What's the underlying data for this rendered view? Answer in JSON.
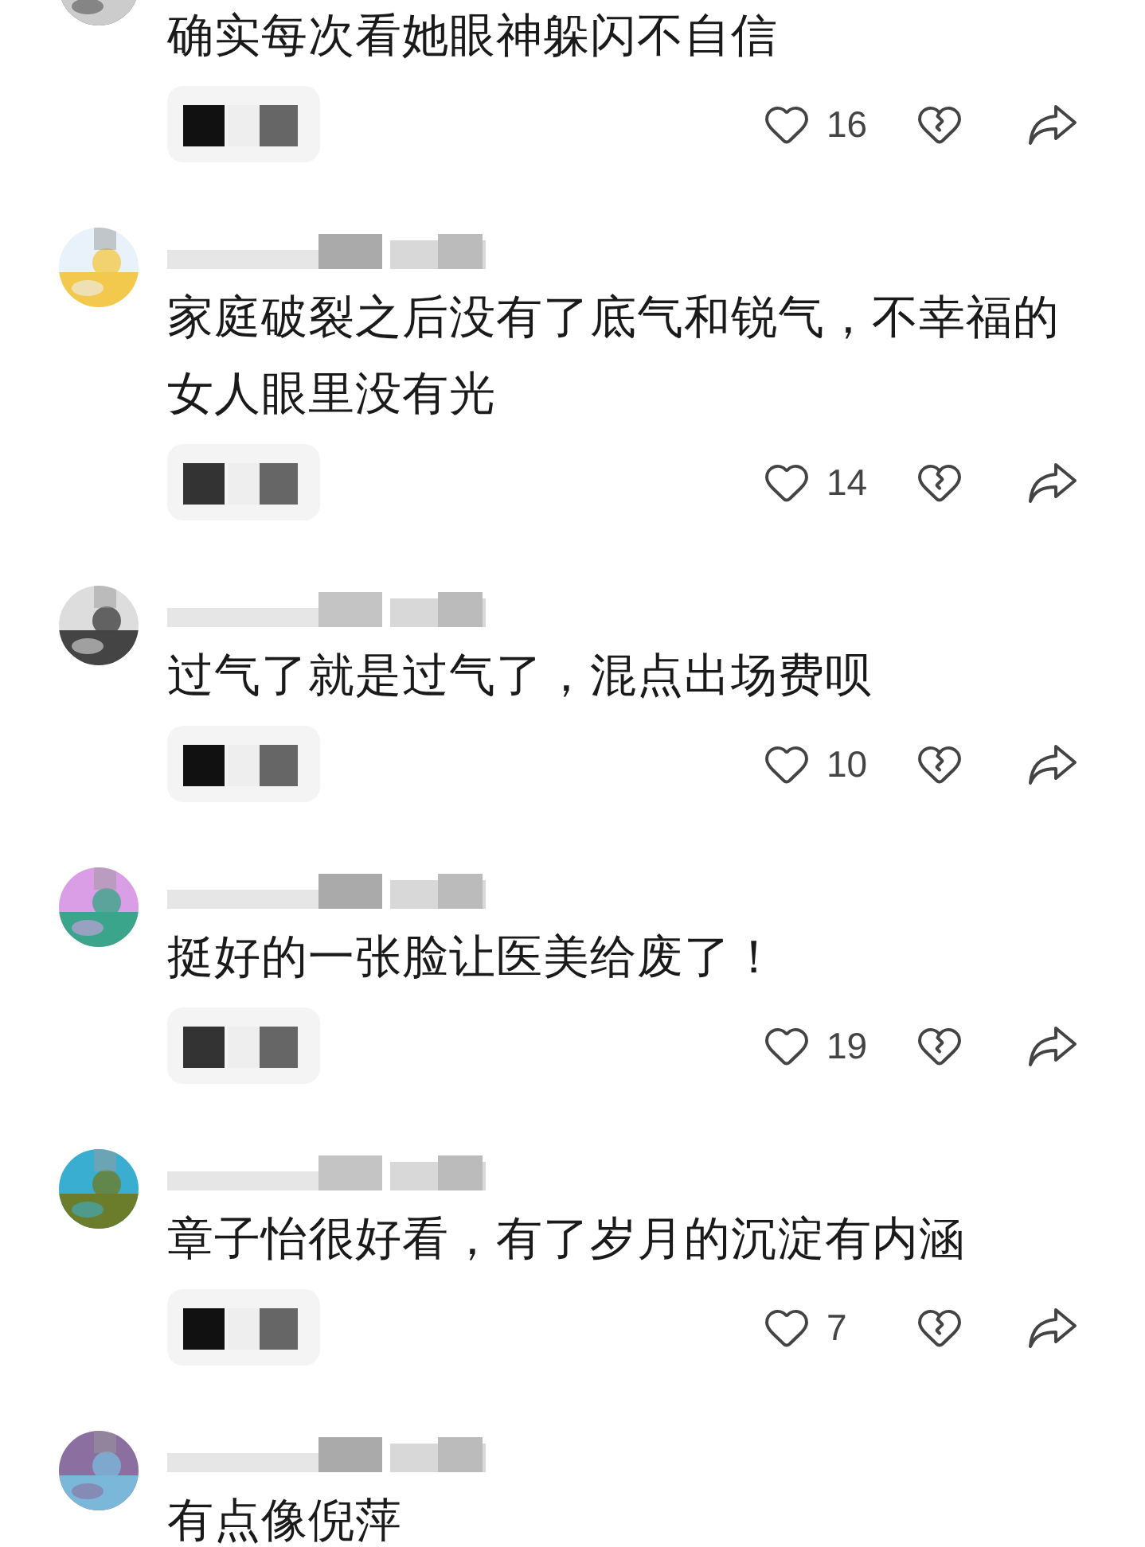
{
  "comments": [
    {
      "text": "确实每次看她眼神躲闪不自信",
      "likes": "16"
    },
    {
      "text": "家庭破裂之后没有了底气和锐气，不幸福的女人眼里没有光",
      "likes": "14"
    },
    {
      "text": "过气了就是过气了，混点出场费呗",
      "likes": "10"
    },
    {
      "text": "挺好的一张脸让医美给废了！",
      "likes": "19"
    },
    {
      "text": "章子怡很好看，有了岁月的沉淀有内涵",
      "likes": "7"
    },
    {
      "text": "有点像倪萍"
    }
  ]
}
